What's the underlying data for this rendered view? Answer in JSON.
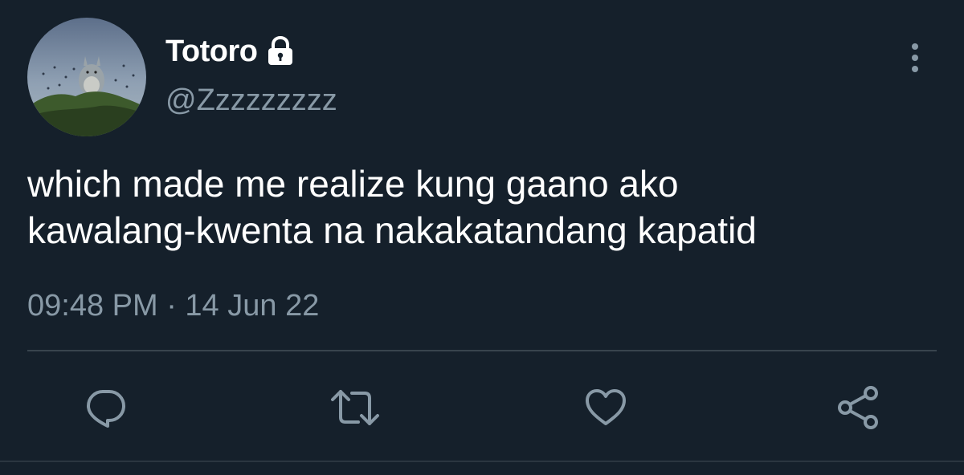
{
  "user": {
    "display_name": "Totoro",
    "handle": "@Zzzzzzzzz",
    "avatar_icon": "totoro-avatar",
    "protected_icon": "lock-icon"
  },
  "tweet": {
    "text_line1": "which made me realize kung gaano ako",
    "text_line2": "kawalang-kwenta na nakakatandang kapatid",
    "timestamp": "09:48 PM · 14 Jun 22"
  },
  "actions": {
    "reply_icon": "reply-icon",
    "retweet_icon": "retweet-icon",
    "like_icon": "heart-icon",
    "share_icon": "share-icon"
  },
  "menu": {
    "more_icon": "more-vertical-icon"
  },
  "colors": {
    "background": "#15202b",
    "text_primary": "#ffffff",
    "text_secondary": "#8899a6",
    "divider": "#38444d"
  }
}
